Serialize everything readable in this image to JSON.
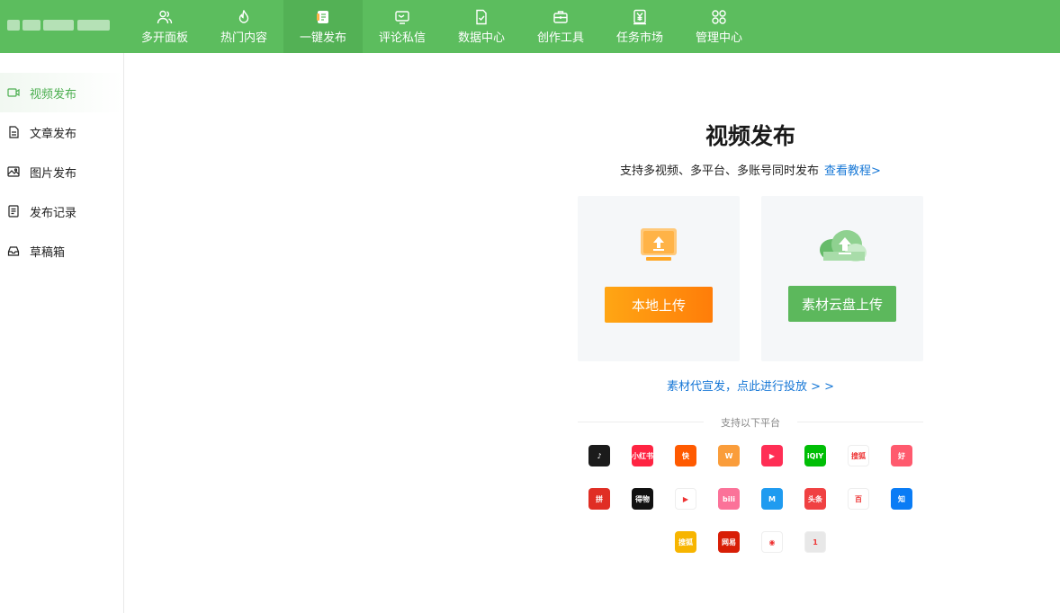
{
  "nav": {
    "items": [
      {
        "label": "多开面板",
        "icon": "users-icon"
      },
      {
        "label": "热门内容",
        "icon": "flame-icon"
      },
      {
        "label": "一键发布",
        "icon": "publish-icon"
      },
      {
        "label": "评论私信",
        "icon": "message-icon"
      },
      {
        "label": "数据中心",
        "icon": "chart-icon"
      },
      {
        "label": "创作工具",
        "icon": "toolbox-icon"
      },
      {
        "label": "任务市场",
        "icon": "yen-icon"
      },
      {
        "label": "管理中心",
        "icon": "grid-icon"
      }
    ],
    "active": "一键发布"
  },
  "sidebar": {
    "items": [
      {
        "label": "视频发布",
        "icon": "video-icon"
      },
      {
        "label": "文章发布",
        "icon": "document-icon"
      },
      {
        "label": "图片发布",
        "icon": "image-icon"
      },
      {
        "label": "发布记录",
        "icon": "record-icon"
      },
      {
        "label": "草稿箱",
        "icon": "drafts-icon"
      }
    ],
    "active": "视频发布"
  },
  "main": {
    "title": "视频发布",
    "subtitle": "支持多视频、多平台、多账号同时发布",
    "tutorial_link": "查看教程>",
    "local_upload": "本地上传",
    "cloud_upload": "素材云盘上传",
    "promo": "素材代宣发，点此进行投放 > >",
    "platforms_label": "支持以下平台"
  },
  "platforms": [
    [
      {
        "name": "douyin-icon",
        "text": "♪",
        "color": "#1b1b1b"
      },
      {
        "name": "xiaohongshu-icon",
        "text": "小红书",
        "color": "#ff2442"
      },
      {
        "name": "kuaishou-icon",
        "text": "快",
        "color": "#ff5a00"
      },
      {
        "name": "wechat-video-icon",
        "text": "W",
        "color": "#fa9d3b"
      },
      {
        "name": "weishi-icon",
        "text": "▶",
        "color": "#ff2e55"
      },
      {
        "name": "iqiyi-icon",
        "text": "iQIY",
        "color": "#00be06"
      },
      {
        "name": "sohu-video-icon",
        "text": "搜狐",
        "color": "#fff"
      },
      {
        "name": "haokan-icon",
        "text": "好",
        "color": "#ff5a6e"
      }
    ],
    [
      {
        "name": "pinduoduo-icon",
        "text": "拼",
        "color": "#e02e24"
      },
      {
        "name": "dewu-icon",
        "text": "得物",
        "color": "#111"
      },
      {
        "name": "tencent-video-icon",
        "text": "▶",
        "color": "#fff"
      },
      {
        "name": "bilibili-icon",
        "text": "bili",
        "color": "#fb7299"
      },
      {
        "name": "meipai-icon",
        "text": "M",
        "color": "#1f9bf0"
      },
      {
        "name": "toutiao-icon",
        "text": "头条",
        "color": "#f04142"
      },
      {
        "name": "baijiahao-icon",
        "text": "百",
        "color": "#fff"
      },
      {
        "name": "zhihu-icon",
        "text": "知",
        "color": "#0a7cf5"
      }
    ],
    [
      {
        "name": "sohu-icon",
        "text": "搜狐",
        "color": "#f7b500"
      },
      {
        "name": "netease-icon",
        "text": "网易",
        "color": "#d81e06"
      },
      {
        "name": "weibo-video-icon",
        "text": "◉",
        "color": "#fff"
      },
      {
        "name": "yidian-icon",
        "text": "1",
        "color": "#e8e8e8"
      }
    ]
  ]
}
